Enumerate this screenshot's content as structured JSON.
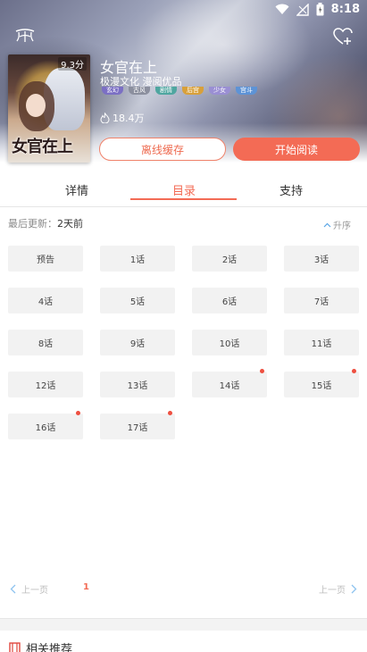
{
  "statusbar": {
    "time": "8:18"
  },
  "comic": {
    "title": "女官在上",
    "author": "极漫文化 漫阅优品",
    "score": "9.3分",
    "cover_text": "女官在上",
    "views": "18.4万",
    "tags": [
      {
        "label": "玄幻",
        "color": "#7b6fc4"
      },
      {
        "label": "古风",
        "color": "#8b8f9e"
      },
      {
        "label": "剧情",
        "color": "#4fa6a0"
      },
      {
        "label": "后宫",
        "color": "#d8a03a"
      },
      {
        "label": "少女",
        "color": "#9a8fd3"
      },
      {
        "label": "宫斗",
        "color": "#5d93d6"
      }
    ]
  },
  "actions": {
    "cache": "离线缓存",
    "read": "开始阅读"
  },
  "tabs": [
    {
      "label": "详情"
    },
    {
      "label": "目录"
    },
    {
      "label": "支持"
    }
  ],
  "catalog": {
    "update_label": "最后更新：",
    "update_value": "2天前",
    "sort_label": "升序",
    "chapters": [
      {
        "label": "预告",
        "new": false
      },
      {
        "label": "1话",
        "new": false
      },
      {
        "label": "2话",
        "new": false
      },
      {
        "label": "3话",
        "new": false
      },
      {
        "label": "4话",
        "new": false
      },
      {
        "label": "5话",
        "new": false
      },
      {
        "label": "6话",
        "new": false
      },
      {
        "label": "7话",
        "new": false
      },
      {
        "label": "8话",
        "new": false
      },
      {
        "label": "9话",
        "new": false
      },
      {
        "label": "10话",
        "new": false
      },
      {
        "label": "11话",
        "new": false
      },
      {
        "label": "12话",
        "new": false
      },
      {
        "label": "13话",
        "new": false
      },
      {
        "label": "14话",
        "new": true
      },
      {
        "label": "15话",
        "new": true
      },
      {
        "label": "16话",
        "new": true
      },
      {
        "label": "17话",
        "new": true
      }
    ]
  },
  "pager": {
    "prev": "上一页",
    "current": "1",
    "next": "上一页"
  },
  "related": {
    "title": "相关推荐"
  },
  "colors": {
    "accent": "#f36b55"
  }
}
